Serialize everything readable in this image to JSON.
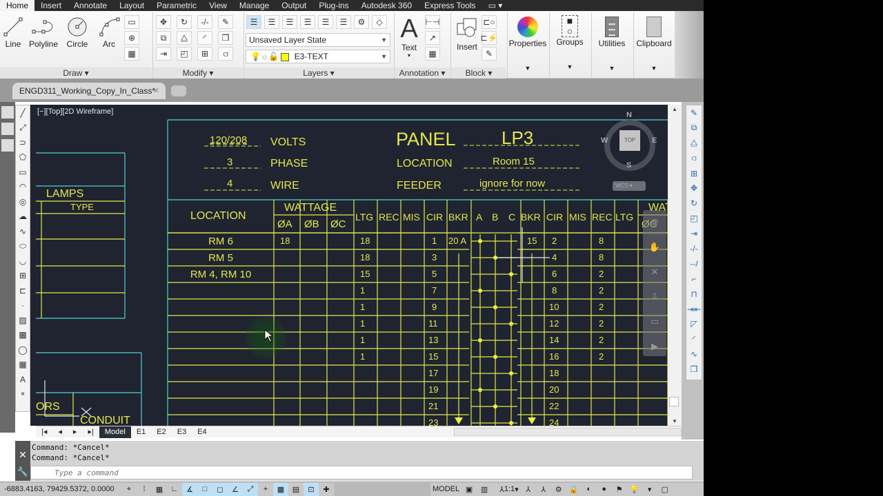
{
  "menu": {
    "tabs": [
      "Home",
      "Insert",
      "Annotate",
      "Layout",
      "Parametric",
      "View",
      "Manage",
      "Output",
      "Plug-ins",
      "Autodesk 360",
      "Express Tools"
    ],
    "active": "Home"
  },
  "ribbon": {
    "draw": {
      "label": "Draw",
      "buttons": [
        "Line",
        "Polyline",
        "Circle",
        "Arc"
      ]
    },
    "modify": {
      "label": "Modify"
    },
    "layers": {
      "label": "Layers",
      "layer_state": "Unsaved Layer State",
      "current_layer": "E3-TEXT",
      "layer_color": "#ffff00"
    },
    "annotation": {
      "label": "Annotation",
      "text_button": "Text"
    },
    "block": {
      "label": "Block",
      "insert_button": "Insert"
    },
    "properties": "Properties",
    "groups": "Groups",
    "utilities": "Utilities",
    "clipboard": "Clipboard"
  },
  "document": {
    "tab_title": "ENGD311_Working_Copy_In_Class*"
  },
  "viewport": {
    "label": "[−][Top][2D Wireframe]"
  },
  "viewcube": {
    "n": "N",
    "s": "S",
    "e": "E",
    "w": "W",
    "top": "TOP",
    "wcs": "WCS"
  },
  "drawing": {
    "volts_value": "120/208",
    "volts_label": "VOLTS",
    "phase_value": "3",
    "phase_label": "PHASE",
    "wire_value": "4",
    "wire_label": "WIRE",
    "panel_label": "PANEL",
    "panel_value": "LP3",
    "location_label": "LOCATION",
    "location_value": "Room 15",
    "feeder_label": "FEEDER",
    "feeder_value": "ignore for now",
    "lamps": "LAMPS",
    "type": "TYPE",
    "ors": "ORS",
    "conduit": "CONDUIT",
    "headers": {
      "location": "LOCATION",
      "wattage": "WATTAGE",
      "phA": "ØA",
      "phB": "ØB",
      "phC": "ØC",
      "ltg": "LTG",
      "rec": "REC",
      "mis": "MIS",
      "cir": "CIR",
      "bkr": "BKR",
      "a": "A",
      "b": "B",
      "c": "C",
      "wat": "WAT",
      "phC2": "ØC"
    },
    "rows": [
      {
        "loc": "RM 6",
        "pa": "18",
        "ltg": "18",
        "cir": "1",
        "bkr": "20 A",
        "rbkr": "15",
        "rcir": "2",
        "rrec": "8"
      },
      {
        "loc": "RM 5",
        "pa": "",
        "ltg": "18",
        "cir": "3",
        "bkr": "",
        "rbkr": "",
        "rcir": "4",
        "rrec": "8"
      },
      {
        "loc": "RM 4, RM 10",
        "pa": "",
        "ltg": "15",
        "cir": "5",
        "bkr": "",
        "rbkr": "",
        "rcir": "6",
        "rrec": "2"
      },
      {
        "loc": "",
        "pa": "",
        "ltg": "1",
        "cir": "7",
        "bkr": "",
        "rbkr": "",
        "rcir": "8",
        "rrec": "2"
      },
      {
        "loc": "",
        "pa": "",
        "ltg": "1",
        "cir": "9",
        "bkr": "",
        "rbkr": "",
        "rcir": "10",
        "rrec": "2"
      },
      {
        "loc": "",
        "pa": "",
        "ltg": "1",
        "cir": "11",
        "bkr": "",
        "rbkr": "",
        "rcir": "12",
        "rrec": "2"
      },
      {
        "loc": "",
        "pa": "",
        "ltg": "1",
        "cir": "13",
        "bkr": "",
        "rbkr": "",
        "rcir": "14",
        "rrec": "2"
      },
      {
        "loc": "",
        "pa": "",
        "ltg": "1",
        "cir": "15",
        "bkr": "",
        "rbkr": "",
        "rcir": "16",
        "rrec": "2"
      },
      {
        "loc": "",
        "pa": "",
        "ltg": "",
        "cir": "17",
        "bkr": "",
        "rbkr": "",
        "rcir": "18",
        "rrec": ""
      },
      {
        "loc": "",
        "pa": "",
        "ltg": "",
        "cir": "19",
        "bkr": "",
        "rbkr": "",
        "rcir": "20",
        "rrec": ""
      },
      {
        "loc": "",
        "pa": "",
        "ltg": "",
        "cir": "21",
        "bkr": "",
        "rbkr": "",
        "rcir": "22",
        "rrec": ""
      },
      {
        "loc": "",
        "pa": "",
        "ltg": "",
        "cir": "23",
        "bkr": "",
        "rbkr": "",
        "rcir": "24",
        "rrec": ""
      }
    ]
  },
  "layout_tabs": [
    "Model",
    "E1",
    "E2",
    "E3",
    "E4"
  ],
  "command": {
    "history": [
      "Command: *Cancel*",
      "Command: *Cancel*"
    ],
    "placeholder": "Type a command"
  },
  "status": {
    "coords": "-6883.4163, 79429.5372, 0.0000",
    "model": "MODEL",
    "scale": "1:1"
  }
}
